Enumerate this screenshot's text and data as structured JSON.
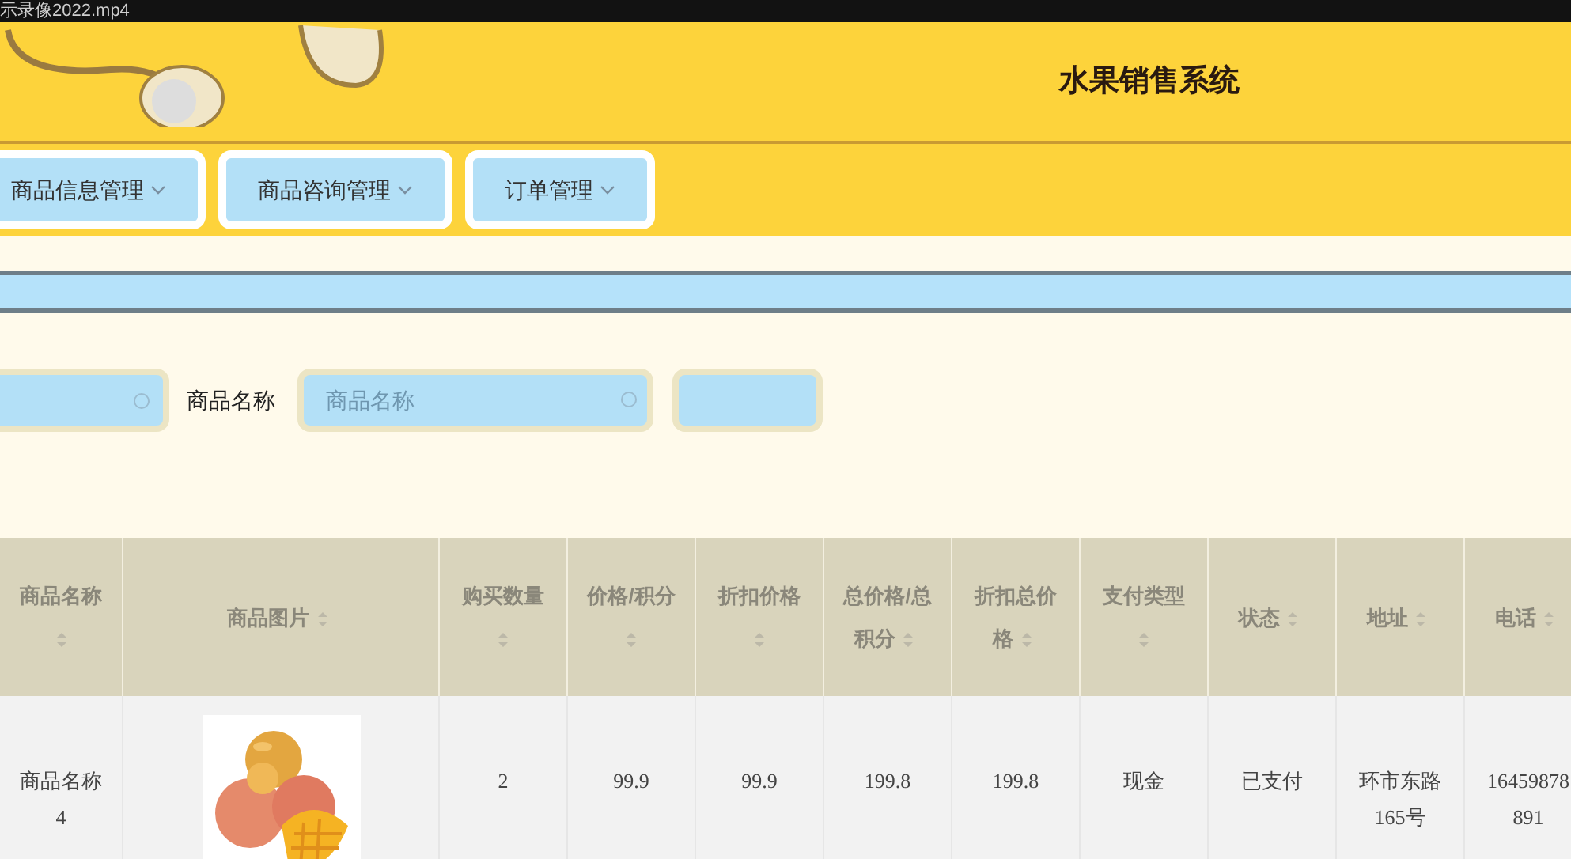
{
  "video_title": "示录像2022.mp4",
  "header": {
    "title": "水果销售系统"
  },
  "nav": [
    {
      "label": "商品信息管理"
    },
    {
      "label": "商品咨询管理"
    },
    {
      "label": "订单管理"
    }
  ],
  "search": {
    "label": "商品名称",
    "placeholder": "商品名称"
  },
  "table": {
    "columns": [
      {
        "label": "商品名称"
      },
      {
        "label": "商品图片"
      },
      {
        "label": "购买数量"
      },
      {
        "label": "价格/积分"
      },
      {
        "label": "折扣价格"
      },
      {
        "label": "总价格/总积分"
      },
      {
        "label": "折扣总价格"
      },
      {
        "label": "支付类型"
      },
      {
        "label": "状态"
      },
      {
        "label": "地址"
      },
      {
        "label": "电话"
      }
    ],
    "rows": [
      {
        "cells": [
          {
            "kind": "text",
            "text": "商品名称4"
          },
          {
            "kind": "picture"
          },
          {
            "kind": "text",
            "text": "2"
          },
          {
            "kind": "text",
            "text": "99.9"
          },
          {
            "kind": "text",
            "text": "99.9"
          },
          {
            "kind": "text",
            "text": "199.8"
          },
          {
            "kind": "text",
            "text": "199.8"
          },
          {
            "kind": "text",
            "text": "现金"
          },
          {
            "kind": "text",
            "text": "已支付"
          },
          {
            "kind": "text",
            "text": "环市东路165号"
          },
          {
            "kind": "text",
            "text": "16459878891"
          }
        ]
      }
    ]
  }
}
